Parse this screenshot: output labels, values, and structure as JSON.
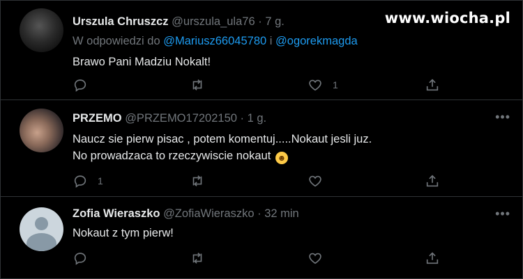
{
  "watermark": "www.wiocha.pl",
  "tweets": [
    {
      "name": "Urszula Chruszcz",
      "handle": "@urszula_ula76",
      "sep": "·",
      "time": "7 g.",
      "reply_prefix": "W odpowiedzi do",
      "reply_user1": "@Mariusz66045780",
      "reply_and": "i",
      "reply_user2": "@ogorekmagda",
      "text_line1": "Brawo Pani Madziu Nokalt!",
      "reply_count": "",
      "retweet_count": "",
      "like_count": "1"
    },
    {
      "name": "PRZEMO",
      "handle": "@PRZEMO17202150",
      "sep": "·",
      "time": "1 g.",
      "text_line1": "Naucz sie pierw pisac , potem komentuj.....Nokaut jesli juz.",
      "text_line2": "No prowadzaca to rzeczywiscie nokaut",
      "emoji": "rolling-on-floor-laughing-emoji",
      "reply_count": "1",
      "retweet_count": "",
      "like_count": ""
    },
    {
      "name": "Zofia Wieraszko",
      "handle": "@ZofiaWieraszko",
      "sep": "·",
      "time": "32 min",
      "text_line1": "Nokaut z tym pierw!",
      "reply_count": "",
      "retweet_count": "",
      "like_count": ""
    }
  ],
  "more_glyph": "•••",
  "colors": {
    "background": "#000000",
    "text": "#e7e9ea",
    "muted": "#71767b",
    "link": "#1d9bf0",
    "border": "#2f3336"
  }
}
